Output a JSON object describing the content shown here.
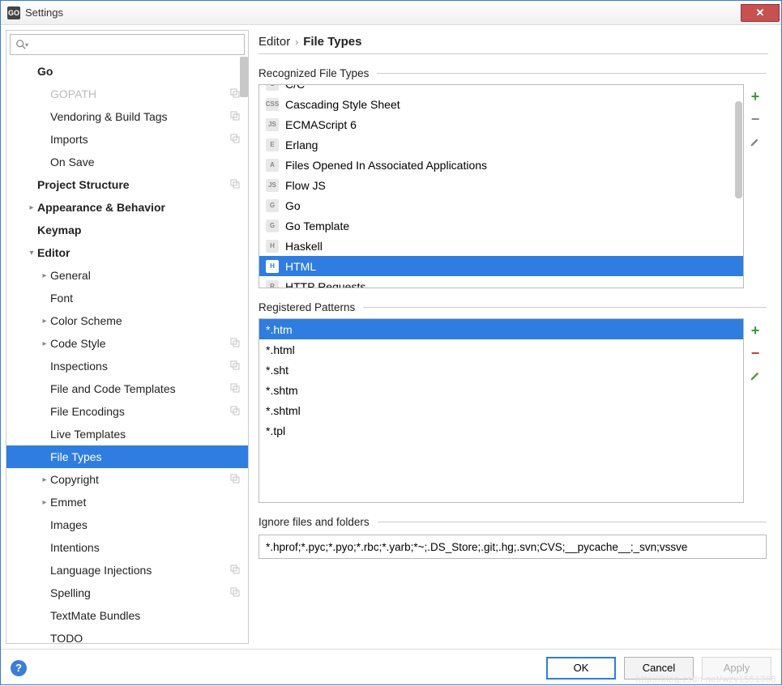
{
  "window": {
    "title": "Settings"
  },
  "search": {
    "placeholder": ""
  },
  "tree": [
    {
      "label": "Go",
      "depth": 0,
      "bold": true,
      "arrow": "",
      "copy": false
    },
    {
      "label": "GOPATH",
      "depth": 1,
      "bold": false,
      "arrow": "",
      "copy": true,
      "dim": true
    },
    {
      "label": "Vendoring & Build Tags",
      "depth": 1,
      "bold": false,
      "arrow": "",
      "copy": true
    },
    {
      "label": "Imports",
      "depth": 1,
      "bold": false,
      "arrow": "",
      "copy": true
    },
    {
      "label": "On Save",
      "depth": 1,
      "bold": false,
      "arrow": "",
      "copy": false
    },
    {
      "label": "Project Structure",
      "depth": 0,
      "bold": true,
      "arrow": "",
      "copy": true
    },
    {
      "label": "Appearance & Behavior",
      "depth": 0,
      "bold": true,
      "arrow": ">",
      "copy": false
    },
    {
      "label": "Keymap",
      "depth": 0,
      "bold": true,
      "arrow": "",
      "copy": false
    },
    {
      "label": "Editor",
      "depth": 0,
      "bold": true,
      "arrow": "v",
      "copy": false
    },
    {
      "label": "General",
      "depth": 1,
      "bold": false,
      "arrow": ">",
      "copy": false
    },
    {
      "label": "Font",
      "depth": 1,
      "bold": false,
      "arrow": "",
      "copy": false
    },
    {
      "label": "Color Scheme",
      "depth": 1,
      "bold": false,
      "arrow": ">",
      "copy": false
    },
    {
      "label": "Code Style",
      "depth": 1,
      "bold": false,
      "arrow": ">",
      "copy": true
    },
    {
      "label": "Inspections",
      "depth": 1,
      "bold": false,
      "arrow": "",
      "copy": true
    },
    {
      "label": "File and Code Templates",
      "depth": 1,
      "bold": false,
      "arrow": "",
      "copy": true
    },
    {
      "label": "File Encodings",
      "depth": 1,
      "bold": false,
      "arrow": "",
      "copy": true
    },
    {
      "label": "Live Templates",
      "depth": 1,
      "bold": false,
      "arrow": "",
      "copy": false
    },
    {
      "label": "File Types",
      "depth": 1,
      "bold": false,
      "arrow": "",
      "copy": false,
      "selected": true
    },
    {
      "label": "Copyright",
      "depth": 1,
      "bold": false,
      "arrow": ">",
      "copy": true
    },
    {
      "label": "Emmet",
      "depth": 1,
      "bold": false,
      "arrow": ">",
      "copy": false
    },
    {
      "label": "Images",
      "depth": 1,
      "bold": false,
      "arrow": "",
      "copy": false
    },
    {
      "label": "Intentions",
      "depth": 1,
      "bold": false,
      "arrow": "",
      "copy": false
    },
    {
      "label": "Language Injections",
      "depth": 1,
      "bold": false,
      "arrow": "",
      "copy": true
    },
    {
      "label": "Spelling",
      "depth": 1,
      "bold": false,
      "arrow": "",
      "copy": true
    },
    {
      "label": "TextMate Bundles",
      "depth": 1,
      "bold": false,
      "arrow": "",
      "copy": false
    },
    {
      "label": "TODO",
      "depth": 1,
      "bold": false,
      "arrow": "",
      "copy": false
    }
  ],
  "breadcrumb": {
    "root": "Editor",
    "leaf": "File Types"
  },
  "sections": {
    "recognized": "Recognized File Types",
    "patterns": "Registered Patterns",
    "ignore": "Ignore files and folders"
  },
  "filetypes": [
    {
      "label": "C/C",
      "icon": "C",
      "cut": true
    },
    {
      "label": "Cascading Style Sheet",
      "icon": "CSS"
    },
    {
      "label": "ECMAScript 6",
      "icon": "JS"
    },
    {
      "label": "Erlang",
      "icon": "E"
    },
    {
      "label": "Files Opened In Associated Applications",
      "icon": "A"
    },
    {
      "label": "Flow JS",
      "icon": "JS"
    },
    {
      "label": "Go",
      "icon": "G"
    },
    {
      "label": "Go Template",
      "icon": "G"
    },
    {
      "label": "Haskell",
      "icon": "H"
    },
    {
      "label": "HTML",
      "icon": "H",
      "selected": true
    },
    {
      "label": "HTTP Requests",
      "icon": "R",
      "cut": true
    }
  ],
  "patterns": [
    {
      "label": "*.htm",
      "selected": true
    },
    {
      "label": "*.html"
    },
    {
      "label": "*.sht"
    },
    {
      "label": "*.shtm"
    },
    {
      "label": "*.shtml"
    },
    {
      "label": "*.tpl"
    }
  ],
  "ignore_value": "*.hprof;*.pyc;*.pyo;*.rbc;*.yarb;*~;.DS_Store;.git;.hg;.svn;CVS;__pycache__;_svn;vssve",
  "buttons": {
    "ok": "OK",
    "cancel": "Cancel",
    "apply": "Apply"
  },
  "watermark": "http://blog.csdn.net/wzy1551368"
}
